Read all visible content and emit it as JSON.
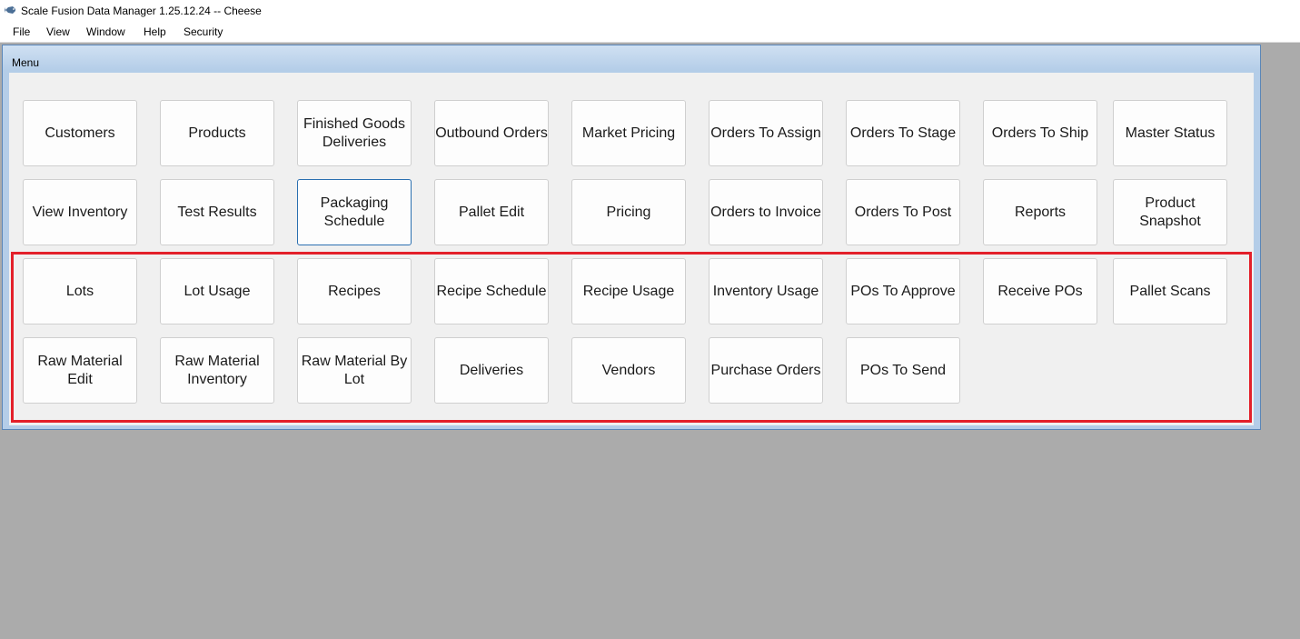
{
  "window": {
    "title": "Scale Fusion Data Manager 1.25.12.24 -- Cheese",
    "app_icon": "fish-icon"
  },
  "menubar": {
    "items": [
      "File",
      "View",
      "Window",
      "Help",
      "Security"
    ]
  },
  "menu_window": {
    "title": "Menu"
  },
  "tiles": {
    "row1": [
      "Customers",
      "Products",
      "Finished Goods Deliveries",
      "Outbound Orders",
      "Market Pricing",
      "Orders To Assign",
      "Orders To Stage",
      "Orders To Ship",
      "Master Status"
    ],
    "row2": [
      "View Inventory",
      "Test Results",
      "Packaging Schedule",
      "Pallet Edit",
      "Pricing",
      "Orders to Invoice",
      "Orders To Post",
      "Reports",
      "Product Snapshot"
    ],
    "row3": [
      "Lots",
      "Lot Usage",
      "Recipes",
      "Recipe Schedule",
      "Recipe Usage",
      "Inventory Usage",
      "POs To Approve",
      "Receive POs",
      "Pallet Scans"
    ],
    "row4": [
      "Raw Material Edit",
      "Raw Material Inventory",
      "Raw Material By Lot",
      "Deliveries",
      "Vendors",
      "Purchase Orders",
      "POs To Send"
    ]
  },
  "colors": {
    "highlight": "#e3202a",
    "focus_border": "#2a6fb0",
    "desktop": "#ababab"
  }
}
